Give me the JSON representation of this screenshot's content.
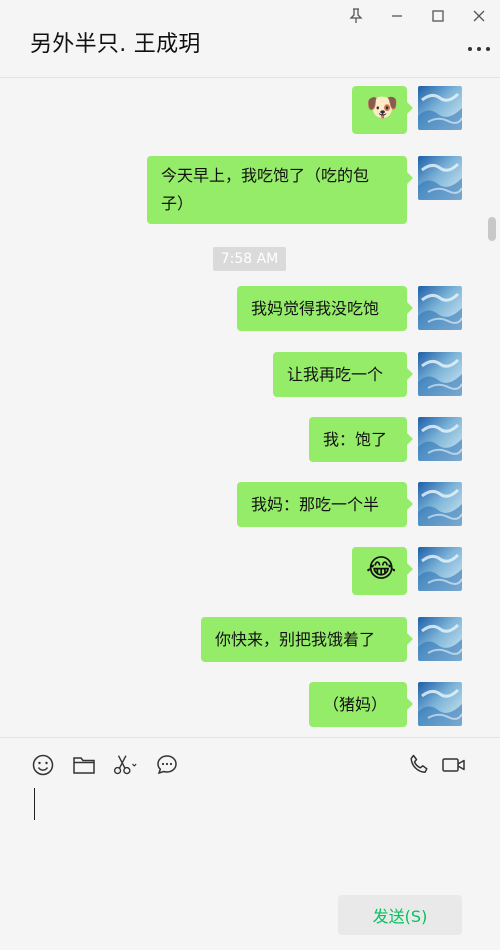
{
  "window": {
    "title": "另外半只. 王成玥",
    "controls": [
      "pin-icon",
      "minimize-icon",
      "maximize-icon",
      "close-icon"
    ]
  },
  "chat": {
    "messages": [
      {
        "type": "emoji",
        "text": "🐶",
        "side": "right"
      },
      {
        "type": "text",
        "lines": [
          "今天早上，我吃饱了（吃的包",
          "子）"
        ],
        "side": "right"
      },
      {
        "type": "time",
        "text": "7:58 AM"
      },
      {
        "type": "text",
        "lines": [
          "我妈觉得我没吃饱"
        ],
        "side": "right"
      },
      {
        "type": "text",
        "lines": [
          "让我再吃一个"
        ],
        "side": "right"
      },
      {
        "type": "text",
        "lines": [
          "我：饱了"
        ],
        "side": "right"
      },
      {
        "type": "text",
        "lines": [
          "我妈：那吃一个半"
        ],
        "side": "right"
      },
      {
        "type": "emoji",
        "text": "😂",
        "side": "right"
      },
      {
        "type": "text",
        "lines": [
          "你快来，别把我饿着了"
        ],
        "side": "right"
      },
      {
        "type": "text",
        "lines": [
          "（猪妈）"
        ],
        "side": "right"
      }
    ]
  },
  "toolbar": {
    "left_icons": [
      "emoji-icon",
      "folder-icon",
      "scissors-icon",
      "chat-history-icon"
    ],
    "right_icons": [
      "phone-icon",
      "video-call-icon"
    ]
  },
  "composer": {
    "value": "",
    "send_label": "发送(S)"
  },
  "colors": {
    "bubble": "#95ec69",
    "background": "#f5f5f5",
    "send_text": "#07c160"
  }
}
